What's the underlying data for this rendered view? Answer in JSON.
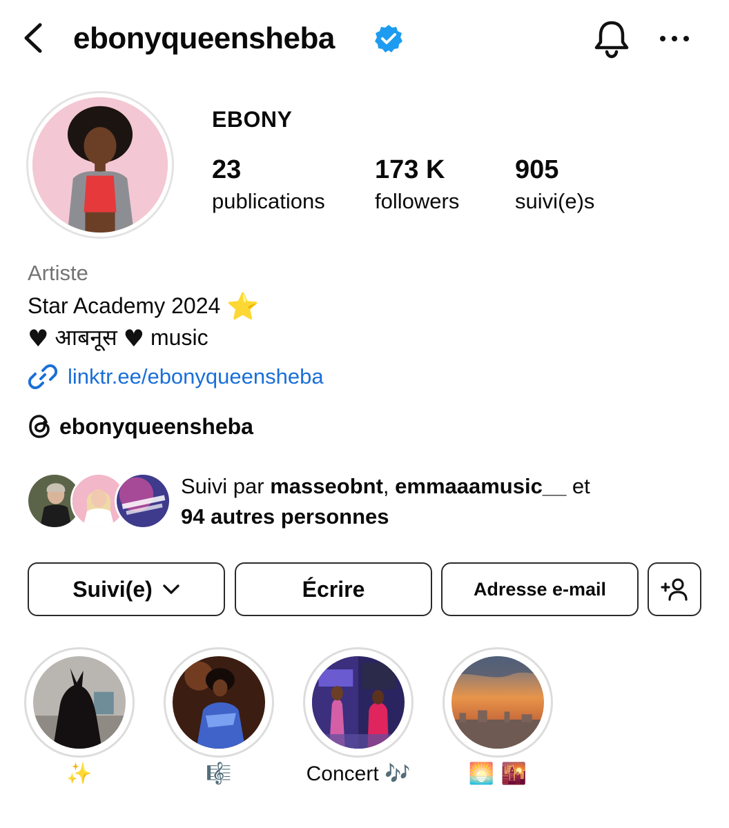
{
  "header": {
    "username": "ebonyqueensheba"
  },
  "profile": {
    "display_name": "EBONY",
    "stats": [
      {
        "value": "23",
        "label": "publications"
      },
      {
        "value": "173 K",
        "label": "followers"
      },
      {
        "value": "905",
        "label": "suivi(e)s"
      }
    ]
  },
  "bio": {
    "category": "Artiste",
    "line1_text": "Star Academy 2024",
    "line1_emoji": "⭐",
    "line2_heart": "♥",
    "line2_word": "आबनूस",
    "line2_music": "music",
    "link": "linktr.ee/ebonyqueensheba",
    "threads_handle": "ebonyqueensheba"
  },
  "followed_by": {
    "prefix": "Suivi par ",
    "user1": "masseobnt",
    "separator": ", ",
    "user2": "emmaaamusic__",
    "suffix": " et",
    "others": "94 autres personnes"
  },
  "buttons": {
    "following": "Suivi(e)",
    "message": "Écrire",
    "email": "Adresse e-mail"
  },
  "highlights": [
    {
      "label": "✨"
    },
    {
      "label": "🎼"
    },
    {
      "label": "Concert 🎶"
    },
    {
      "label": "🌅 🌇"
    }
  ],
  "colors": {
    "verified_blue": "#1d9bf0",
    "link_blue": "#1a6fd8",
    "secondary_text": "#737373"
  },
  "icons": [
    "back-icon",
    "verified-icon",
    "bell-icon",
    "more-icon",
    "link-icon",
    "threads-icon",
    "chevron-down-icon",
    "add-user-icon"
  ]
}
